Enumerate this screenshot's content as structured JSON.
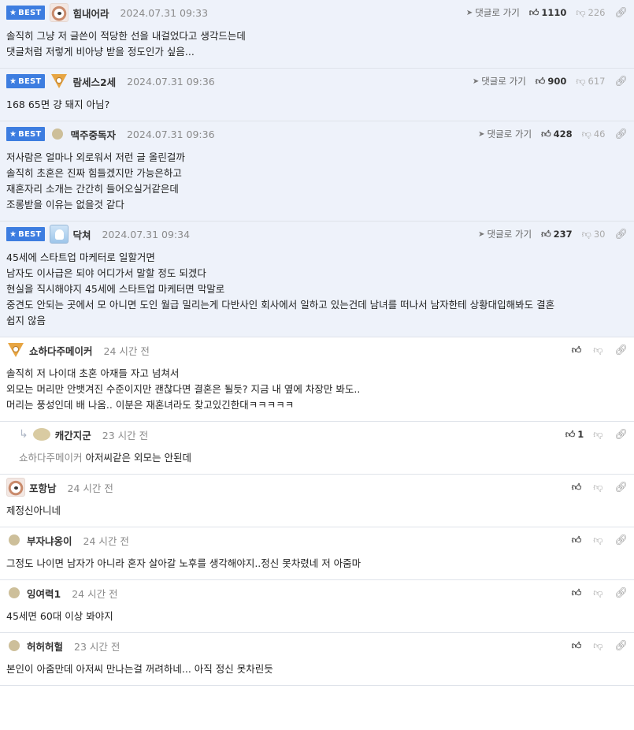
{
  "labels": {
    "best": "BEST",
    "goto_reply": "댓글로 가기"
  },
  "comments": [
    {
      "best": true,
      "avatar": "dog",
      "nick": "힘내어라",
      "date": "2024.07.31 09:33",
      "up": "1110",
      "down": "226",
      "lines": [
        "솔직히 그냥 저 글쓴이 적당한 선을 내걸었다고 생각드는데",
        "댓글처럼 저렇게 비아냥 받을 정도인가 싶음..."
      ]
    },
    {
      "best": true,
      "avatar": "fox",
      "nick": "람세스2세",
      "date": "2024.07.31 09:36",
      "up": "900",
      "down": "617",
      "lines": [
        "168 65면 걍 돼지 아님?"
      ]
    },
    {
      "best": true,
      "avatar": "dot",
      "nick": "맥주중독자",
      "date": "2024.07.31 09:36",
      "up": "428",
      "down": "46",
      "lines": [
        "저사람은 얼마나 외로워서 저런 글 올린걸까",
        "솔직히 초혼은 진짜 힘들겠지만 가능은하고",
        "재혼자리 소개는 간간히 들어오실거같은데",
        "조롱받을 이유는 없을것 같다"
      ]
    },
    {
      "best": true,
      "avatar": "ghost",
      "nick": "닥쳐",
      "date": "2024.07.31 09:34",
      "up": "237",
      "down": "30",
      "lines": [
        "45세에 스타트업 마케터로 일할거면",
        "남자도 이사급은 되야 어디가서 말할 정도 되겠다",
        "현실을 직시해야지 45세에 스타트업 마케터면 막말로",
        "중견도 안되는 곳에서 모 아니면 도인 월급 밀리는게 다반사인 회사에서 일하고 있는건데 남녀를 떠나서 남자한테 상황대입해봐도 결혼",
        "쉽지 않음"
      ]
    },
    {
      "best": false,
      "avatar": "fox",
      "nick": "쇼하다주메이커",
      "date": "24 시간 전",
      "up": "",
      "down": "",
      "lines": [
        "솔직히 저 나이대 초혼 아재들 자고 넘쳐서",
        "외모는 머리만 안뱃겨진 수준이지만 괜찮다면 결혼은 될듯? 지금 내 옆에 차장만 봐도..",
        "머리는 풍성인데 배 나옴.. 이분은 재혼녀라도 찾고있긴한대ㅋㅋㅋㅋㅋ"
      ]
    },
    {
      "best": false,
      "reply": true,
      "avatar": "blob",
      "nick": "캐간지군",
      "date": "23 시간 전",
      "up": "1",
      "down": "",
      "mention": "쇼하다주메이커",
      "lines": [
        "아저씨같은 외모는 안된데"
      ]
    },
    {
      "best": false,
      "avatar": "dog",
      "nick": "포항남",
      "date": "24 시간 전",
      "up": "",
      "down": "",
      "lines": [
        "제정신아니네"
      ]
    },
    {
      "best": false,
      "avatar": "dot",
      "nick": "부자냐옹이",
      "date": "24 시간 전",
      "up": "",
      "down": "",
      "lines": [
        "그정도 나이면 남자가 아니라 혼자 살아갈 노후를 생각해야지..정신 못차렸네 저 아줌마"
      ]
    },
    {
      "best": false,
      "avatar": "dot",
      "nick": "잉여력1",
      "date": "24 시간 전",
      "up": "",
      "down": "",
      "lines": [
        "45세면 60대 이상 봐야지"
      ]
    },
    {
      "best": false,
      "avatar": "dot",
      "nick": "허허허헐",
      "date": "23 시간 전",
      "up": "",
      "down": "",
      "lines": [
        "본인이 아줌만데 아저씨 만나는걸 꺼려하네... 아직 정신 못차린듯"
      ]
    }
  ]
}
